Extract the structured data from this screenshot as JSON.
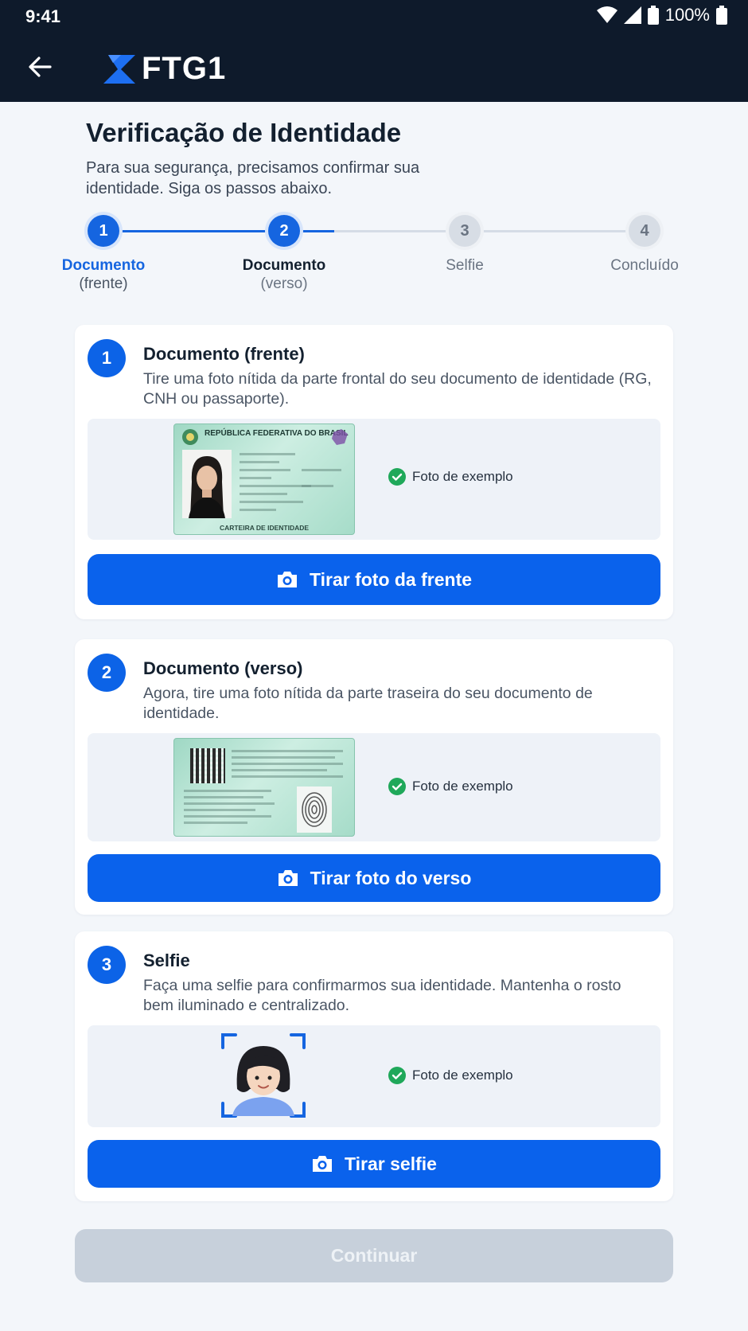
{
  "status_bar": {
    "time": "9:41",
    "battery": "100%"
  },
  "app_bar": {
    "back_icon": "arrow-left-icon",
    "brand": "FTG1"
  },
  "header": {
    "title": "Verificação de Identidade",
    "subtitle": "Para sua segurança, precisamos confirmar sua identidade. Siga os passos abaixo."
  },
  "stepper": {
    "current_step": 2,
    "steps": [
      {
        "number": "1",
        "label_line1": "Documento",
        "label_line2": "(frente)",
        "state": "active"
      },
      {
        "number": "2",
        "label_line1": "Documento",
        "label_line2": "(verso)",
        "state": "active"
      },
      {
        "number": "3",
        "label_line1": "Selfie",
        "label_line2": "",
        "state": "pending"
      },
      {
        "number": "4",
        "label_line1": "Concluído",
        "label_line2": "",
        "state": "pending"
      }
    ]
  },
  "cards": [
    {
      "number": "1",
      "title": "Documento (frente)",
      "description": "Tire uma foto nítida da parte frontal do seu documento de identidade (RG, CNH ou passaporte).",
      "example_label": "Foto de exemplo",
      "card_header": "REPÚBLICA FEDERATIVA DO BRASIL",
      "card_footer": "CARTEIRA DE IDENTIDADE",
      "button_label": "Tirar foto da frente",
      "button_icon": "camera-icon"
    },
    {
      "number": "2",
      "title": "Documento (verso)",
      "description": "Agora, tire uma foto nítida da parte traseira do seu documento de identidade.",
      "example_label": "Foto de exemplo",
      "button_label": "Tirar foto do verso",
      "button_icon": "camera-icon"
    },
    {
      "number": "3",
      "title": "Selfie",
      "description": "Faça uma selfie para confirmarmos sua identidade. Mantenha o rosto bem iluminado e centralizado.",
      "example_label": "Foto de exemplo",
      "button_label": "Tirar selfie",
      "button_icon": "camera-icon"
    }
  ],
  "footer": {
    "continue_label": "Continuar",
    "continue_enabled": false
  },
  "colors": {
    "primary": "#0a62ec",
    "app_bar": "#0e1a2b",
    "disabled": "#c7d0db",
    "success": "#1fa85a"
  }
}
